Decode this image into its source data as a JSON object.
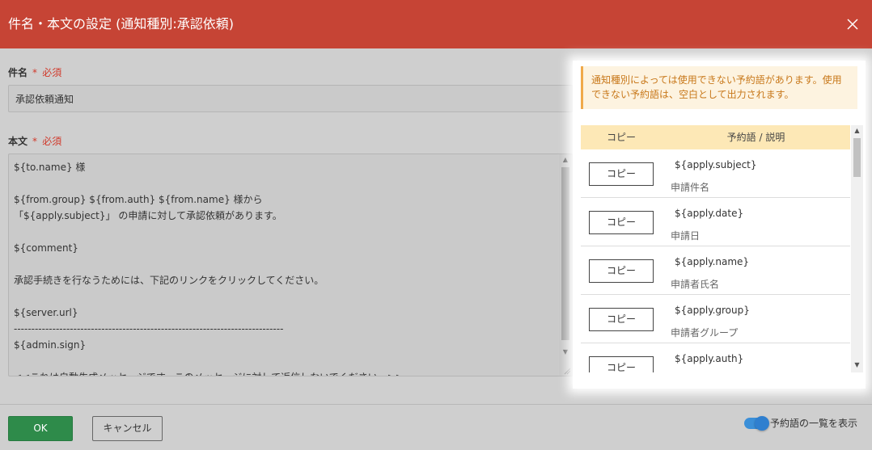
{
  "dialog": {
    "title": "件名・本文の設定 (通知種別:承認依頼)"
  },
  "colors": {
    "header_bg": "#c64435",
    "ok_bg": "#2e8b4a",
    "notice_text": "#c8781a",
    "table_header_bg": "#fde8b6",
    "toggle_on": "#3b8fd8"
  },
  "icons": {
    "close": "close-icon",
    "scroll_up": "chevron-up-icon",
    "scroll_down": "chevron-down-icon",
    "resize": "resize-grip-icon"
  },
  "subject": {
    "label": "件名",
    "required_mark": "*",
    "required_text": "必須",
    "value": "承認依頼通知"
  },
  "body": {
    "label": "本文",
    "required_mark": "*",
    "required_text": "必須",
    "value": "${to.name} 様\n\n${from.group} ${from.auth} ${from.name} 様から\n「${apply.subject}」 の申請に対して承認依頼があります。\n\n${comment}\n\n承認手続きを行なうためには、下記のリンクをクリックしてください。\n\n${server.url}\n-----------------------------------------------------------------------------\n${admin.sign}\n\n<<これは自動生成メッセージです。このメッセージに対して返信しないでください。>>"
  },
  "reserved": {
    "notice": "通知種別によっては使用できない予約語があります。使用できない予約語は、空白として出力されます。",
    "header_copy": "コピー",
    "header_desc": "予約語 / 説明",
    "rows": [
      {
        "copy_label": "コピー",
        "name": "${apply.subject}",
        "desc": "申請件名"
      },
      {
        "copy_label": "コピー",
        "name": "${apply.date}",
        "desc": "申請日"
      },
      {
        "copy_label": "コピー",
        "name": "${apply.name}",
        "desc": "申請者氏名"
      },
      {
        "copy_label": "コピー",
        "name": "${apply.group}",
        "desc": "申請者グループ"
      },
      {
        "copy_label": "コピー",
        "name": "${apply.auth}",
        "desc": ""
      }
    ]
  },
  "footer": {
    "ok_label": "OK",
    "cancel_label": "キャンセル",
    "toggle_label": "予約語の一覧を表示",
    "toggle_on": true
  }
}
